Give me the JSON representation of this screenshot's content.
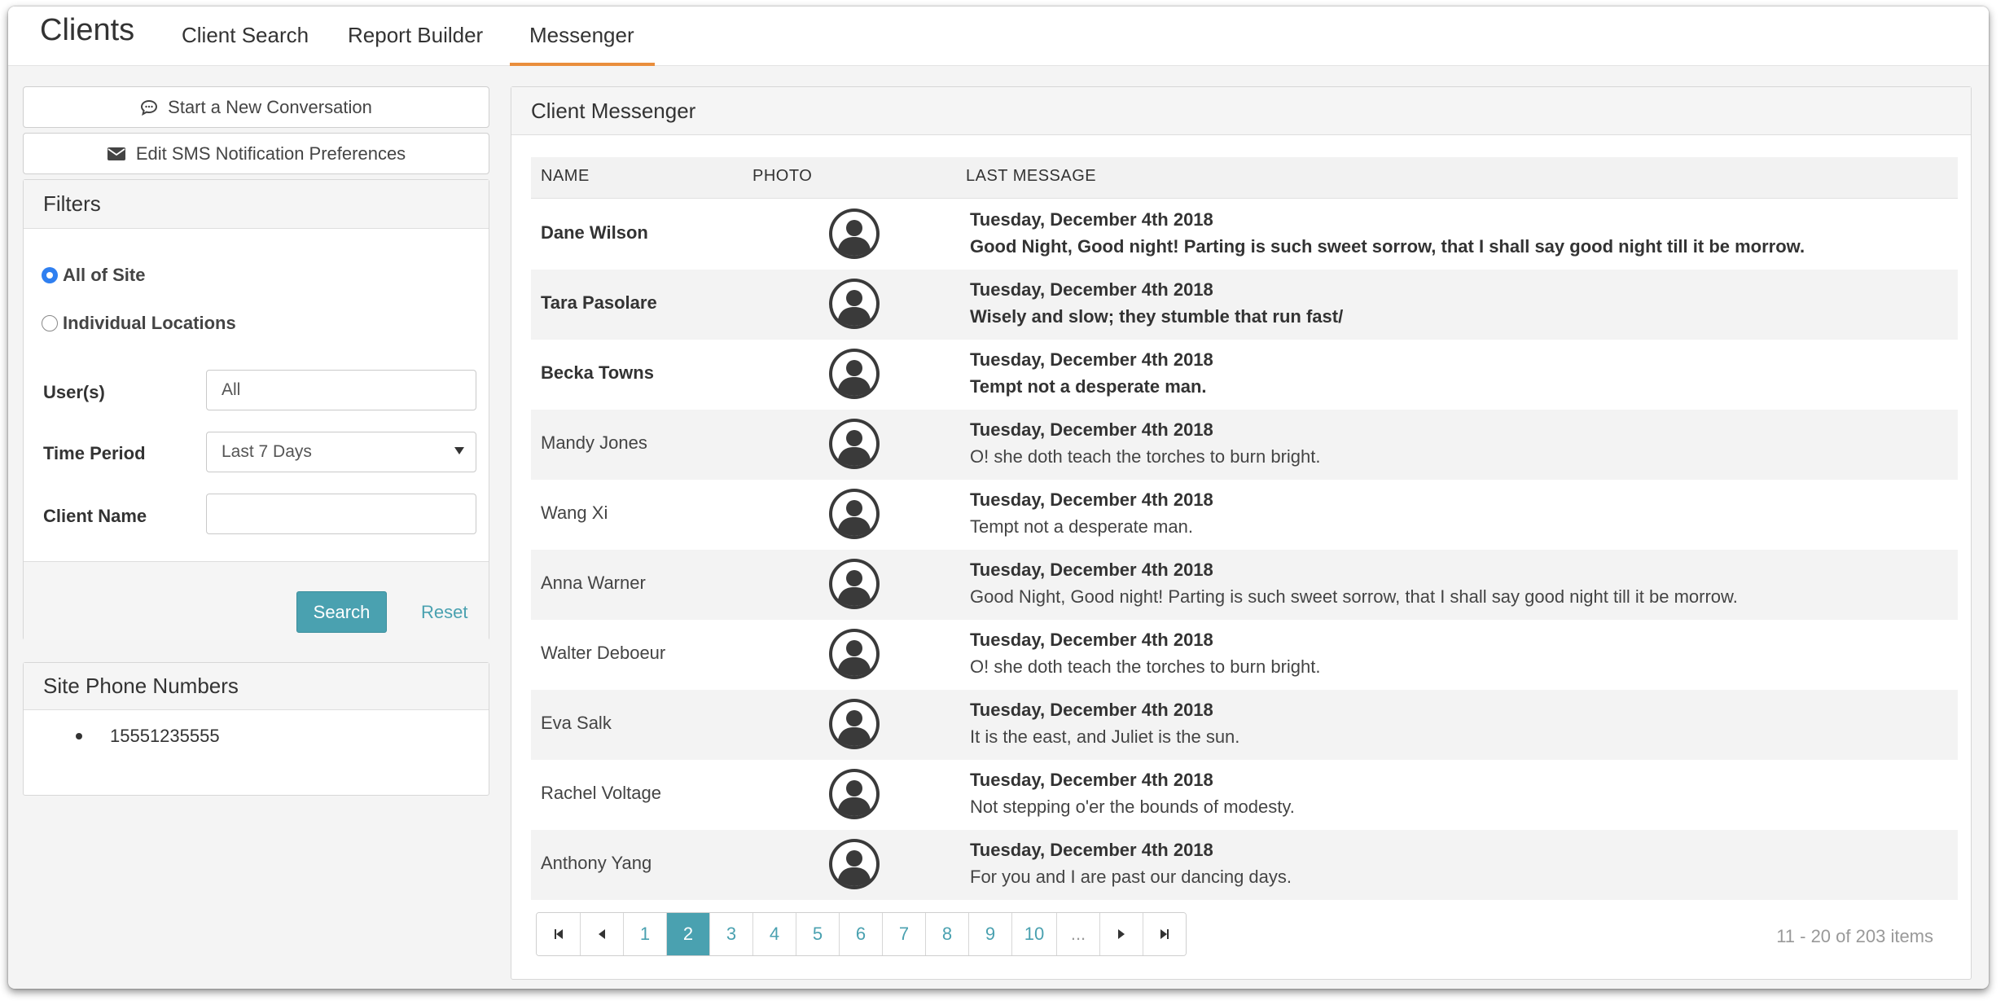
{
  "header": {
    "brand": "Clients",
    "tabs": [
      {
        "label": "Client Search"
      },
      {
        "label": "Report Builder"
      },
      {
        "label": "Messenger",
        "active": true
      }
    ],
    "accent_color": "#e98e3c"
  },
  "sidebar": {
    "new_conversation_label": "Start a New Conversation",
    "sms_prefs_label": "Edit SMS Notification Preferences",
    "filters": {
      "title": "Filters",
      "scope_options": [
        {
          "label": "All of Site",
          "selected": true
        },
        {
          "label": "Individual Locations",
          "selected": false
        }
      ],
      "users_label": "User(s)",
      "users_value": "All",
      "time_period_label": "Time Period",
      "time_period_value": "Last 7 Days",
      "client_name_label": "Client Name",
      "client_name_value": "",
      "search_label": "Search",
      "reset_label": "Reset"
    },
    "phone_numbers": {
      "title": "Site Phone Numbers",
      "numbers": [
        "15551235555"
      ]
    }
  },
  "messenger": {
    "title": "Client Messenger",
    "columns": {
      "name": "NAME",
      "photo": "PHOTO",
      "last_message": "LAST MESSAGE"
    },
    "rows": [
      {
        "name": "Dane Wilson",
        "date": "Tuesday, December 4th 2018",
        "message": "Good Night, Good night! Parting is such sweet sorrow, that I shall say good night till it be morrow.",
        "unread": true
      },
      {
        "name": "Tara Pasolare",
        "date": "Tuesday, December 4th 2018",
        "message": "Wisely and slow; they stumble that run fast/",
        "unread": true
      },
      {
        "name": "Becka Towns",
        "date": "Tuesday, December 4th 2018",
        "message": "Tempt not a desperate man.",
        "unread": true
      },
      {
        "name": "Mandy Jones",
        "date": "Tuesday, December 4th 2018",
        "message": "O! she doth teach the torches to burn bright.",
        "unread": false
      },
      {
        "name": "Wang Xi",
        "date": "Tuesday, December 4th 2018",
        "message": "Tempt not a desperate man.",
        "unread": false
      },
      {
        "name": "Anna Warner",
        "date": "Tuesday, December 4th 2018",
        "message": "Good Night, Good night! Parting is such sweet sorrow, that I shall say good night till it be morrow.",
        "unread": false
      },
      {
        "name": "Walter Deboeur",
        "date": "Tuesday, December 4th 2018",
        "message": "O! she doth teach the torches to burn bright.",
        "unread": false
      },
      {
        "name": "Eva Salk",
        "date": "Tuesday, December 4th 2018",
        "message": "It is the east, and Juliet is the sun.",
        "unread": false
      },
      {
        "name": "Rachel Voltage",
        "date": "Tuesday, December 4th 2018",
        "message": "Not stepping o'er the bounds of modesty.",
        "unread": false
      },
      {
        "name": "Anthony Yang",
        "date": "Tuesday, December 4th 2018",
        "message": "For you and I are past our dancing days.",
        "unread": false
      }
    ],
    "pager": {
      "pages": [
        "1",
        "2",
        "3",
        "4",
        "5",
        "6",
        "7",
        "8",
        "9",
        "10",
        "..."
      ],
      "current_page": "2",
      "info": "11 - 20 of 203 items"
    },
    "primary_color": "#4aa1b0"
  }
}
